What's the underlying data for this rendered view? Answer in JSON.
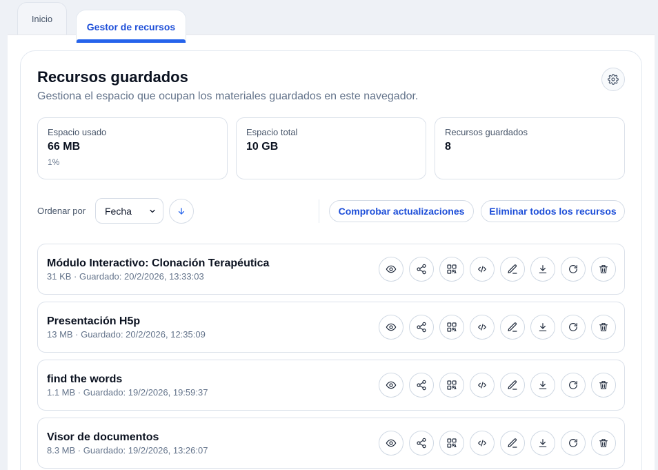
{
  "tabs": [
    {
      "label": "Inicio"
    },
    {
      "label": "Gestor de recursos"
    }
  ],
  "header": {
    "title": "Recursos guardados",
    "subtitle": "Gestiona el espacio que ocupan los materiales guardados en este navegador.",
    "settings_icon": "gear-icon"
  },
  "stats": [
    {
      "label": "Espacio usado",
      "value": "66 MB",
      "sub": "1%"
    },
    {
      "label": "Espacio total",
      "value": "10 GB"
    },
    {
      "label": "Recursos guardados",
      "value": "8"
    }
  ],
  "toolbar": {
    "sort_label": "Ordenar por",
    "sort_value": "Fecha",
    "sort_direction_icon": "arrow-down-icon",
    "check_updates_label": "Comprobar actualizaciones",
    "delete_all_label": "Eliminar todos los recursos"
  },
  "resources": [
    {
      "name": "Módulo Interactivo: Clonación Terapéutica",
      "meta": "31 KB · Guardado: 20/2/2026, 13:33:03"
    },
    {
      "name": "Presentación H5p",
      "meta": "13 MB · Guardado: 20/2/2026, 12:35:09"
    },
    {
      "name": "find the words",
      "meta": "1.1 MB · Guardado: 19/2/2026, 19:59:37"
    },
    {
      "name": "Visor de documentos",
      "meta": "8.3 MB · Guardado: 19/2/2026, 13:26:07"
    }
  ],
  "row_actions": [
    "eye-icon",
    "share-icon",
    "qr-code-icon",
    "code-icon",
    "pencil-icon",
    "download-icon",
    "refresh-icon",
    "trash-icon"
  ],
  "colors": {
    "accent": "#2563eb",
    "accent_text": "#1d4ed8",
    "text": "#0f172a",
    "muted": "#64748b",
    "border": "#dbe1ea"
  }
}
